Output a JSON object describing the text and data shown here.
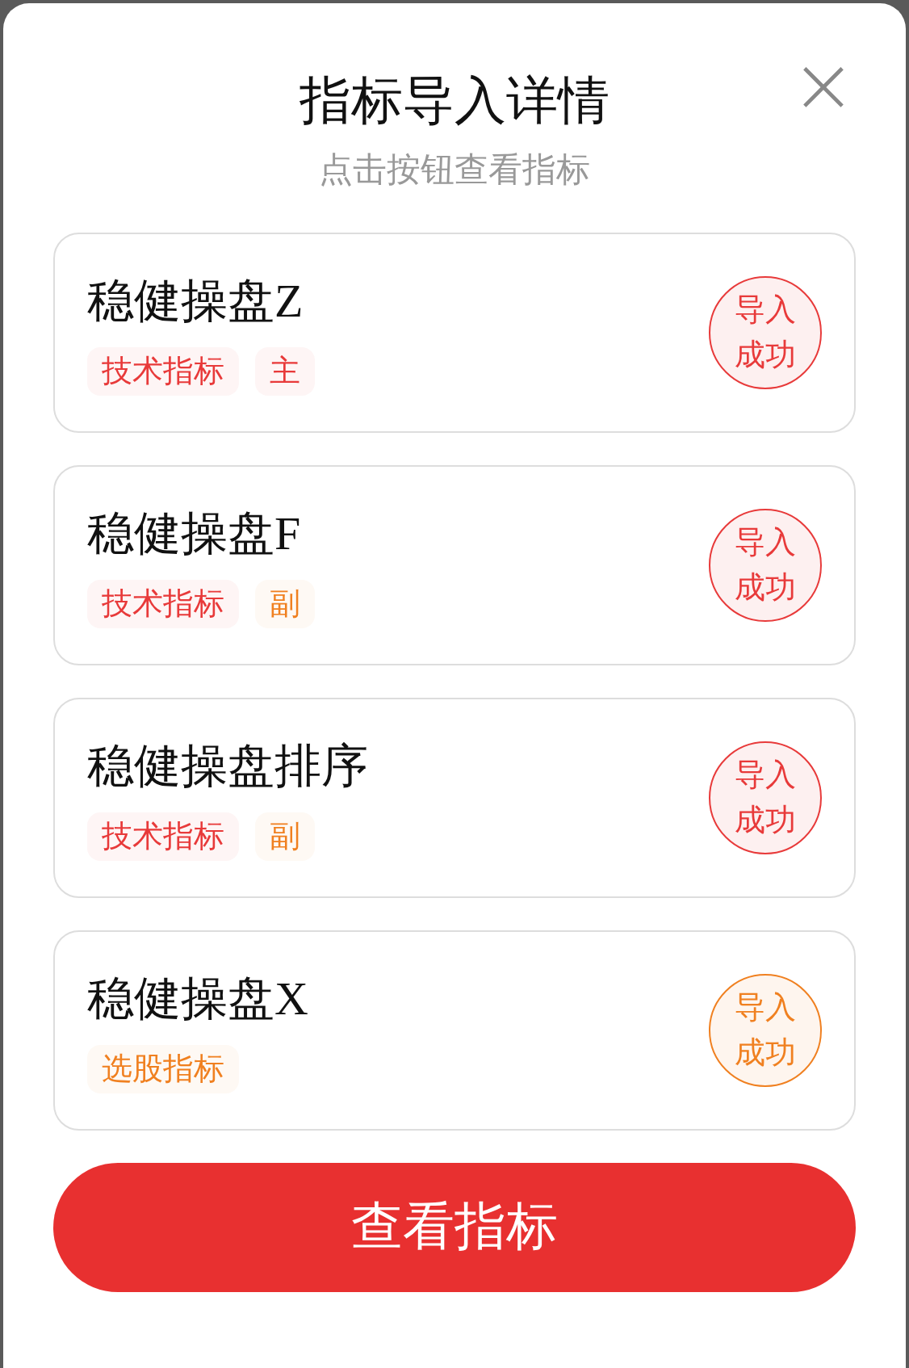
{
  "dialog": {
    "title": "指标导入详情",
    "subtitle": "点击按钮查看指标",
    "close": "×"
  },
  "items": [
    {
      "name": "稳健操盘Z",
      "tags": [
        {
          "label": "技术指标",
          "color": "#e83a3a"
        },
        {
          "label": "主",
          "color": "#e83a3a"
        }
      ],
      "status": {
        "label": "导入成功",
        "color": "#e83a3a"
      }
    },
    {
      "name": "稳健操盘F",
      "tags": [
        {
          "label": "技术指标",
          "color": "#e83a3a"
        },
        {
          "label": "副",
          "color": "#f08020"
        }
      ],
      "status": {
        "label": "导入成功",
        "color": "#e83a3a"
      }
    },
    {
      "name": "稳健操盘排序",
      "tags": [
        {
          "label": "技术指标",
          "color": "#e83a3a"
        },
        {
          "label": "副",
          "color": "#f08020"
        }
      ],
      "status": {
        "label": "导入成功",
        "color": "#e83a3a"
      }
    },
    {
      "name": "稳健操盘X",
      "tags": [
        {
          "label": "选股指标",
          "color": "#f08020"
        }
      ],
      "status": {
        "label": "导入成功",
        "color": "#f08020"
      }
    }
  ],
  "button": "查看指标"
}
